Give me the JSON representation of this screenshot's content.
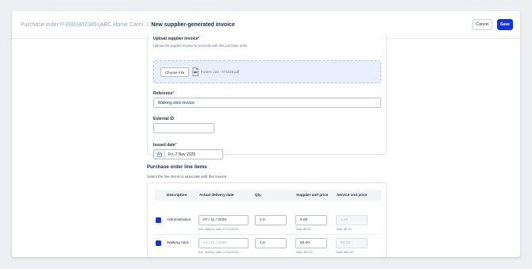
{
  "header": {
    "breadcrumb_parent": "Purchase order P-0000402389 (ABC Home Care)",
    "breadcrumb_separator": "/",
    "title": "New supplier-generated invoice",
    "cancel_label": "Cancel",
    "save_label": "Save"
  },
  "form": {
    "upload": {
      "label": "Upload supplier invoice",
      "required_mark": "*",
      "help": "Upload the supplier invoice to reconcile with this purchase order",
      "choose_file_label": "Choose File",
      "file_name": "Invoice 123 - 071025.pdf"
    },
    "reference": {
      "label": "Reference",
      "required_mark": "*",
      "value": "Walking stick invoice"
    },
    "external_id": {
      "label": "External ID",
      "value": ""
    },
    "issued_date": {
      "label": "Issued date",
      "required_mark": "*",
      "value": "Fri, 7 Nov 2025"
    }
  },
  "line_items": {
    "title": "Purchase order line items",
    "subtitle": "Select the line items to associate with this invoice",
    "columns": [
      "Description",
      "Actual delivery date",
      "Qty",
      "Supplier unit price",
      "Service unit price"
    ],
    "rows": [
      {
        "checked": true,
        "description": "Administration",
        "delivery_date": "07 / 11 / 2025",
        "est_delivery": "Est. delivery date: 07/11/2025",
        "qty": "1.0",
        "supplier_price": "5.00",
        "supplier_total": "Total: $5.00",
        "service_price": "5.00",
        "service_total": "Total: $5.00"
      },
      {
        "checked": true,
        "description": "Walking stick",
        "delivery_date": "24 / 11 / 2025",
        "est_delivery": "Est. delivery date: 07/11/2025",
        "qty": "1.0",
        "supplier_price": "50.00",
        "supplier_total": "Total: $50.00",
        "service_price": "50.00",
        "service_total": "Total: $50.00"
      }
    ]
  },
  "colors": {
    "accent": "#1633d6",
    "required": "#d6324a"
  },
  "icons": [
    "calendar-icon",
    "file-icon",
    "checkbox-checked-icon"
  ]
}
